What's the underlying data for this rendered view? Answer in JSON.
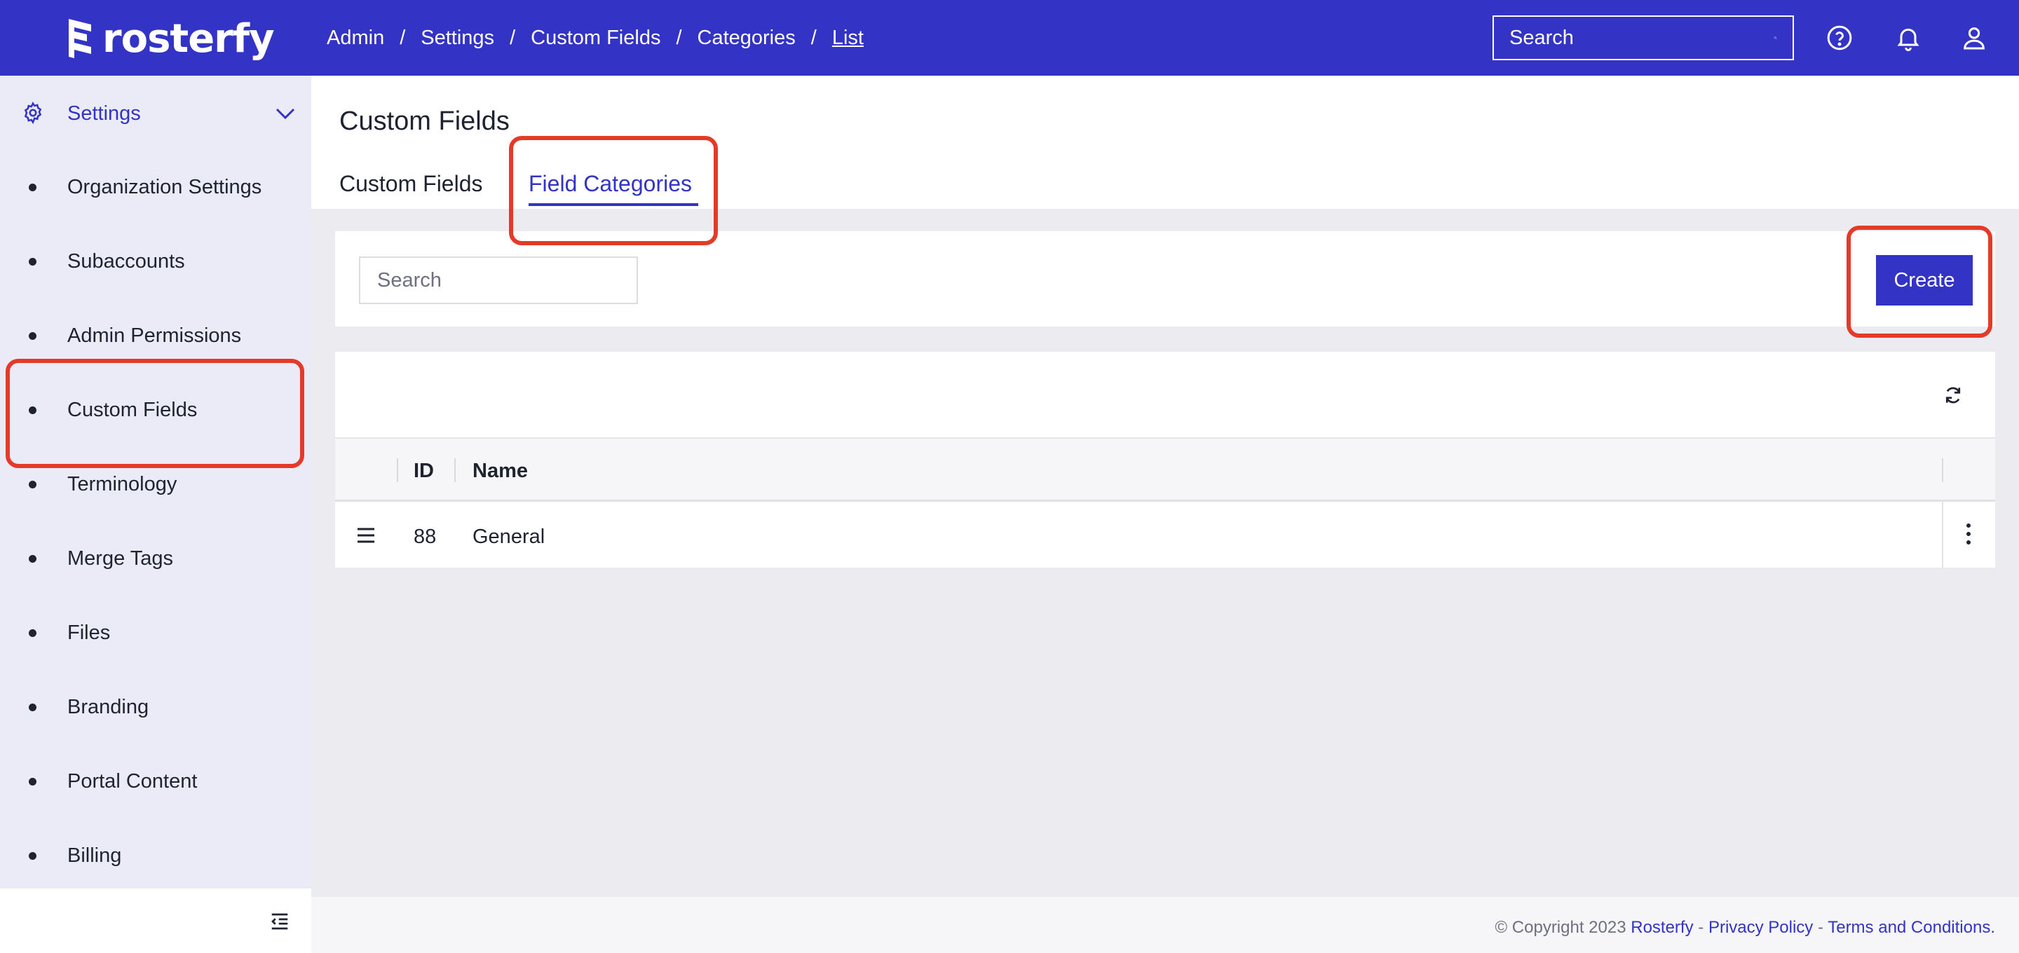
{
  "app": {
    "brand": "rosterfy"
  },
  "breadcrumb": [
    "Admin",
    "Settings",
    "Custom Fields",
    "Categories",
    "List"
  ],
  "top_search": {
    "placeholder": "Search"
  },
  "sidebar": {
    "section": "Settings",
    "items": [
      {
        "label": "Organization Settings"
      },
      {
        "label": "Subaccounts"
      },
      {
        "label": "Admin Permissions"
      },
      {
        "label": "Custom Fields"
      },
      {
        "label": "Terminology"
      },
      {
        "label": "Merge Tags"
      },
      {
        "label": "Files"
      },
      {
        "label": "Branding"
      },
      {
        "label": "Portal Content"
      },
      {
        "label": "Billing"
      }
    ]
  },
  "page": {
    "title": "Custom Fields",
    "tabs": [
      {
        "label": "Custom Fields",
        "active": false
      },
      {
        "label": "Field Categories",
        "active": true
      }
    ]
  },
  "toolbar": {
    "search_placeholder": "Search",
    "create_label": "Create"
  },
  "table": {
    "columns": [
      "ID",
      "Name"
    ],
    "rows": [
      {
        "id": "88",
        "name": "General"
      }
    ]
  },
  "footer": {
    "copyright": "© Copyright 2023",
    "brand_link": "Rosterfy",
    "sep1": "-",
    "privacy": "Privacy Policy",
    "sep2": "-",
    "terms": "Terms and Conditions."
  },
  "colors": {
    "primary": "#3333c6",
    "sidebar_bg": "#ebebf8",
    "annotation": "#e33a2a"
  }
}
